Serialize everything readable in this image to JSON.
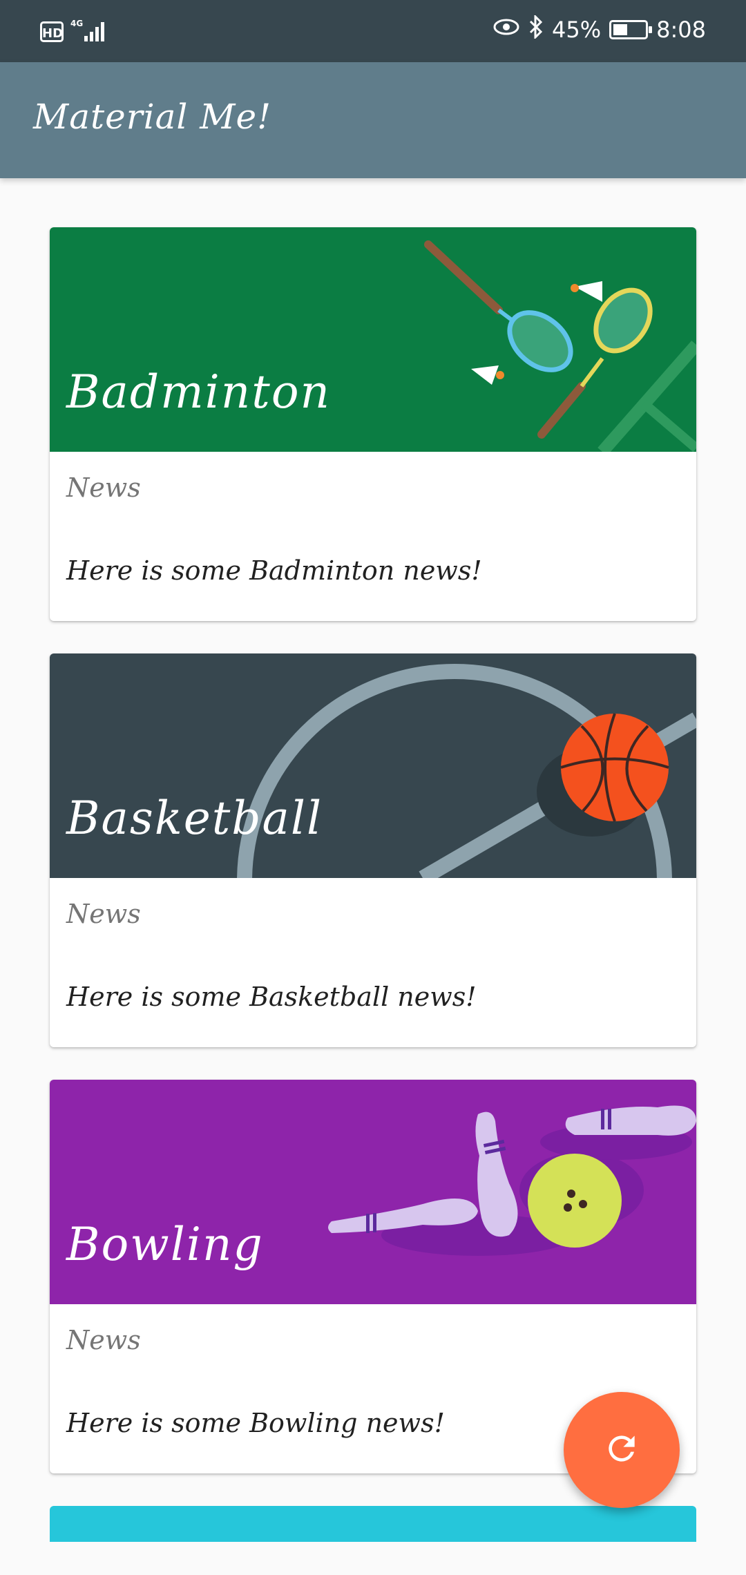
{
  "status_bar": {
    "hd_label": "HD",
    "network_label": "4G",
    "battery_percent": "45%",
    "time": "8:08",
    "icons": [
      "eye-icon",
      "bluetooth-icon",
      "signal-icon",
      "battery-icon"
    ]
  },
  "app_bar": {
    "title": "Material Me!",
    "color": "#607d8b"
  },
  "cards": [
    {
      "title": "Badminton",
      "subtitle": "News",
      "body": "Here is some Badminton news!",
      "color": "#0b7d43"
    },
    {
      "title": "Basketball",
      "subtitle": "News",
      "body": "Here is some Basketball news!",
      "color": "#37474f"
    },
    {
      "title": "Bowling",
      "subtitle": "News",
      "body": "Here is some Bowling news!",
      "color": "#8e24aa"
    }
  ],
  "partial_card": {
    "color": "#26c6da"
  },
  "fab": {
    "icon": "refresh-icon",
    "color": "#ff6e40"
  }
}
